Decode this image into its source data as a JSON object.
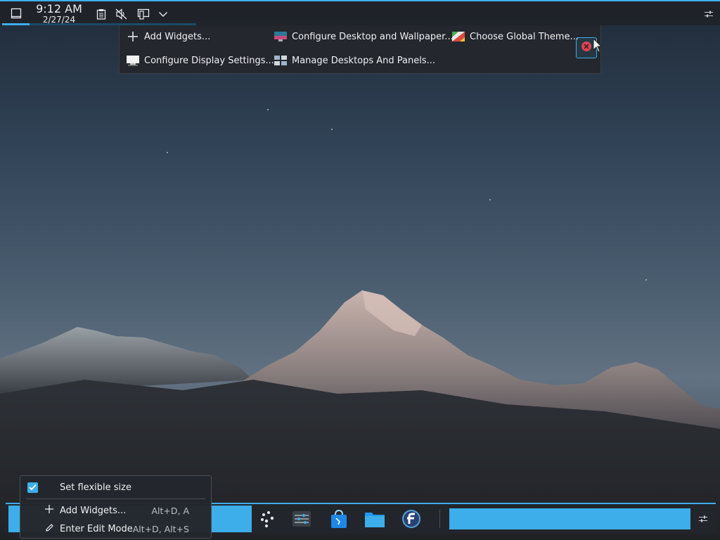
{
  "top_panel": {
    "clock": {
      "time": "9:12 AM",
      "date": "2/27/24"
    },
    "icons": [
      "show-desktop-icon",
      "clipboard-icon",
      "volume-muted-icon",
      "network-icon",
      "chevron-down-icon"
    ],
    "right_icon": "panel-settings-icon",
    "accent": "#3daee9"
  },
  "desktop_menu": {
    "items": [
      {
        "label": "Add Widgets...",
        "icon": "plus-icon"
      },
      {
        "label": "Configure Desktop and Wallpaper...",
        "icon": "wallpaper-icon"
      },
      {
        "label": "Choose Global Theme...",
        "icon": "theme-icon"
      },
      {
        "label": "Configure Display Settings...",
        "icon": "display-icon"
      },
      {
        "label": "Manage Desktops And Panels...",
        "icon": "manage-desktops-icon"
      }
    ],
    "close_icon": "close-icon"
  },
  "panel_menu": {
    "flexible": {
      "label": "Set flexible size",
      "checked": true
    },
    "add_widgets": {
      "label": "Add Widgets...",
      "shortcut": "Alt+D, A"
    },
    "edit_mode": {
      "label": "Enter Edit Mode",
      "shortcut": "Alt+D, Alt+S"
    }
  },
  "bottom_panel": {
    "tasks": [
      "app-launcher-icon",
      "system-settings-icon",
      "discover-store-icon",
      "dolphin-files-icon",
      "fedora-icon"
    ],
    "right_icon": "panel-settings-icon"
  }
}
